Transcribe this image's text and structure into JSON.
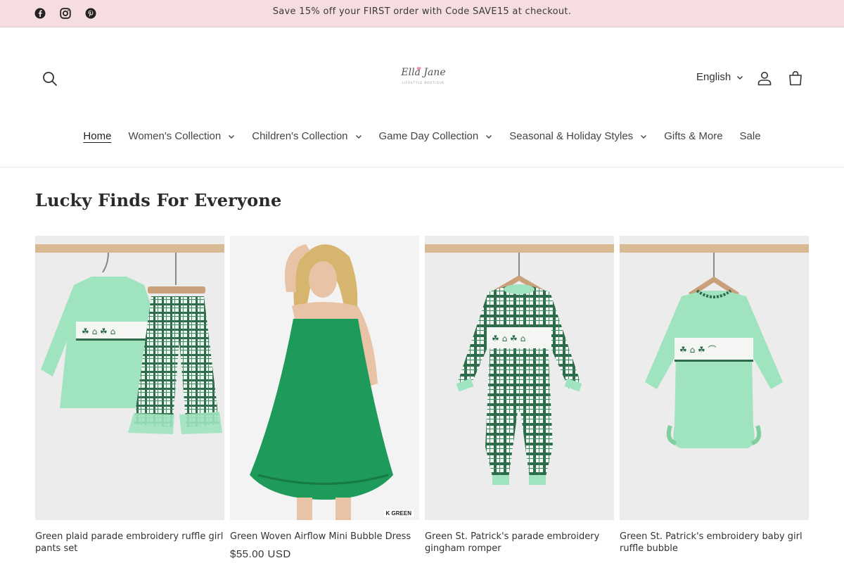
{
  "announcement": {
    "text": "Save 15% off your FIRST order with Code SAVE15 at checkout.",
    "social": [
      "facebook-icon",
      "instagram-icon",
      "pinterest-icon"
    ]
  },
  "header": {
    "logo_text": "Ella Jane",
    "logo_sub": "LIFESTYLE BOUTIQUE",
    "language": "English"
  },
  "nav": {
    "items": [
      {
        "label": "Home",
        "dropdown": false,
        "active": true
      },
      {
        "label": "Women's Collection",
        "dropdown": true
      },
      {
        "label": "Children's Collection",
        "dropdown": true
      },
      {
        "label": "Game Day Collection",
        "dropdown": true
      },
      {
        "label": "Seasonal & Holiday Styles",
        "dropdown": true
      },
      {
        "label": "Gifts & More",
        "dropdown": false
      },
      {
        "label": "Sale",
        "dropdown": false
      }
    ]
  },
  "section": {
    "title": "Lucky Finds For Everyone"
  },
  "products": [
    {
      "title": "Green plaid parade embroidery ruffle girl pants set",
      "price": ""
    },
    {
      "title": "Green Woven Airflow Mini Bubble Dress",
      "price": "$55.00 USD",
      "tag": "K GREEN"
    },
    {
      "title": "Green St. Patrick's parade embroidery gingham romper",
      "price": ""
    },
    {
      "title": "Green St. Patrick's embroidery baby girl ruffle bubble",
      "price": ""
    }
  ],
  "colors": {
    "announcement_bg": "#f6dde2",
    "mint": "#9fe3bf",
    "plaid": "#2e6b4a",
    "dress": "#1e9a5a"
  }
}
